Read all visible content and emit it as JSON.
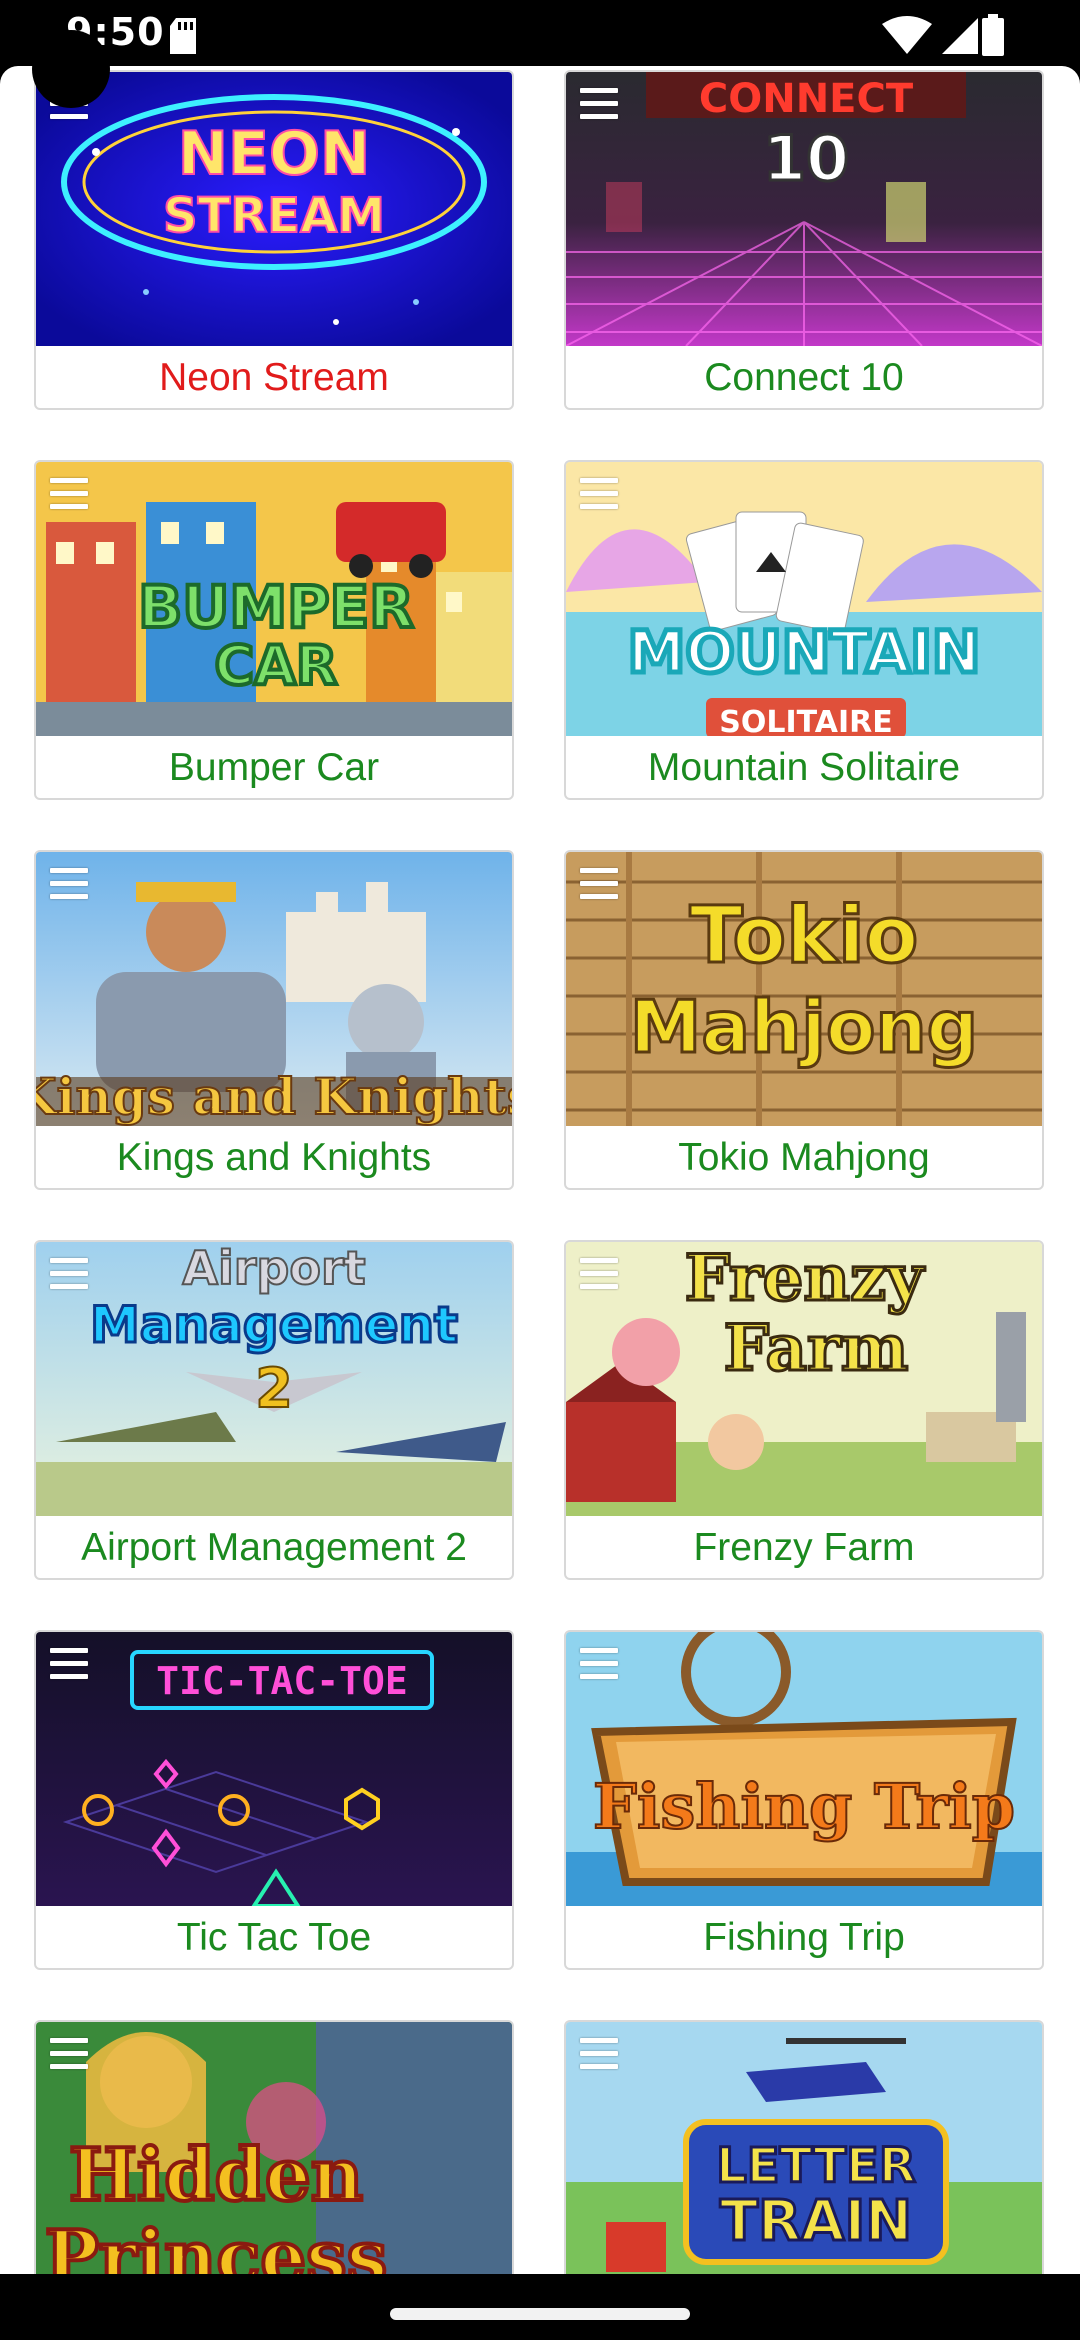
{
  "status": {
    "time": "9:50"
  },
  "games": [
    {
      "title": "Neon Stream",
      "art_text": [
        "NEON",
        "STREAM"
      ],
      "title_color": "#e11b1b"
    },
    {
      "title": "Connect 10",
      "art_text": [
        "CONNECT",
        "10"
      ],
      "title_color": "#1b8a1f"
    },
    {
      "title": "Bumper Car",
      "art_text": [
        "BUMPER",
        "CAR"
      ],
      "title_color": "#1b8a1f"
    },
    {
      "title": "Mountain Solitaire",
      "art_text": [
        "MOUNTAIN",
        "SOLITAIRE"
      ],
      "title_color": "#1b8a1f"
    },
    {
      "title": "Kings and Knights",
      "art_text": [
        "Kings and Knights"
      ],
      "title_color": "#1b8a1f"
    },
    {
      "title": "Tokio Mahjong",
      "art_text": [
        "Tokio",
        "Mahjong"
      ],
      "title_color": "#1b8a1f"
    },
    {
      "title": "Airport Management 2",
      "art_text": [
        "Airport",
        "Management",
        "2"
      ],
      "title_color": "#1b8a1f"
    },
    {
      "title": "Frenzy Farm",
      "art_text": [
        "Frenzy",
        "Farm"
      ],
      "title_color": "#1b8a1f"
    },
    {
      "title": "Tic Tac Toe",
      "art_text": [
        "TIC-TAC-TOE"
      ],
      "title_color": "#1b8a1f"
    },
    {
      "title": "Fishing Trip",
      "art_text": [
        "Fishing Trip"
      ],
      "title_color": "#1b8a1f"
    },
    {
      "title": "",
      "art_text": [
        "Hidden",
        "Princess"
      ],
      "title_color": "#1b8a1f"
    },
    {
      "title": "",
      "art_text": [
        "LETTER",
        "TRAIN"
      ],
      "title_color": "#1b8a1f"
    }
  ],
  "icons": {
    "menu": "menu-icon",
    "wifi": "wifi-icon",
    "signal": "signal-icon",
    "battery": "battery-icon",
    "sd": "sd-card-icon"
  }
}
